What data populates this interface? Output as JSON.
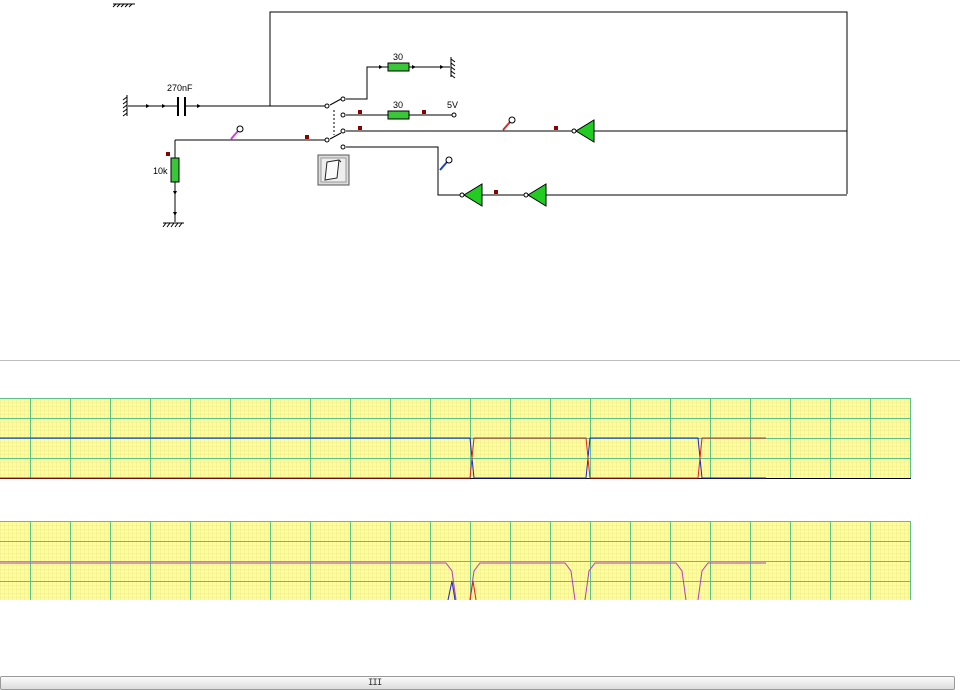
{
  "components": {
    "capacitor": {
      "label": "270nF"
    },
    "resistor_top": {
      "label": "30"
    },
    "resistor_mid": {
      "label": "30"
    },
    "supply": {
      "label": "5V"
    },
    "resistor_bottom": {
      "label": "10k"
    }
  },
  "icons": {
    "ground": "ground-icon",
    "switch": "rotary-switch-icon",
    "probe": "probe-icon",
    "buffer": "buffer-triangle-icon",
    "toggle": "toggle-button-icon"
  },
  "colors": {
    "component_fill": "#39c739",
    "buffer_fill": "#22cc22",
    "probe_marker": "#8b0000",
    "scope_bg": "#fdfd9a",
    "scope_minor_grid": "#e6e08a",
    "scope_major_grid": "#5cc08c",
    "trace_red": "#e02020",
    "trace_blue": "#2020d0",
    "trace_purple": "#b040c0"
  },
  "splitter": {
    "grip": "III"
  }
}
